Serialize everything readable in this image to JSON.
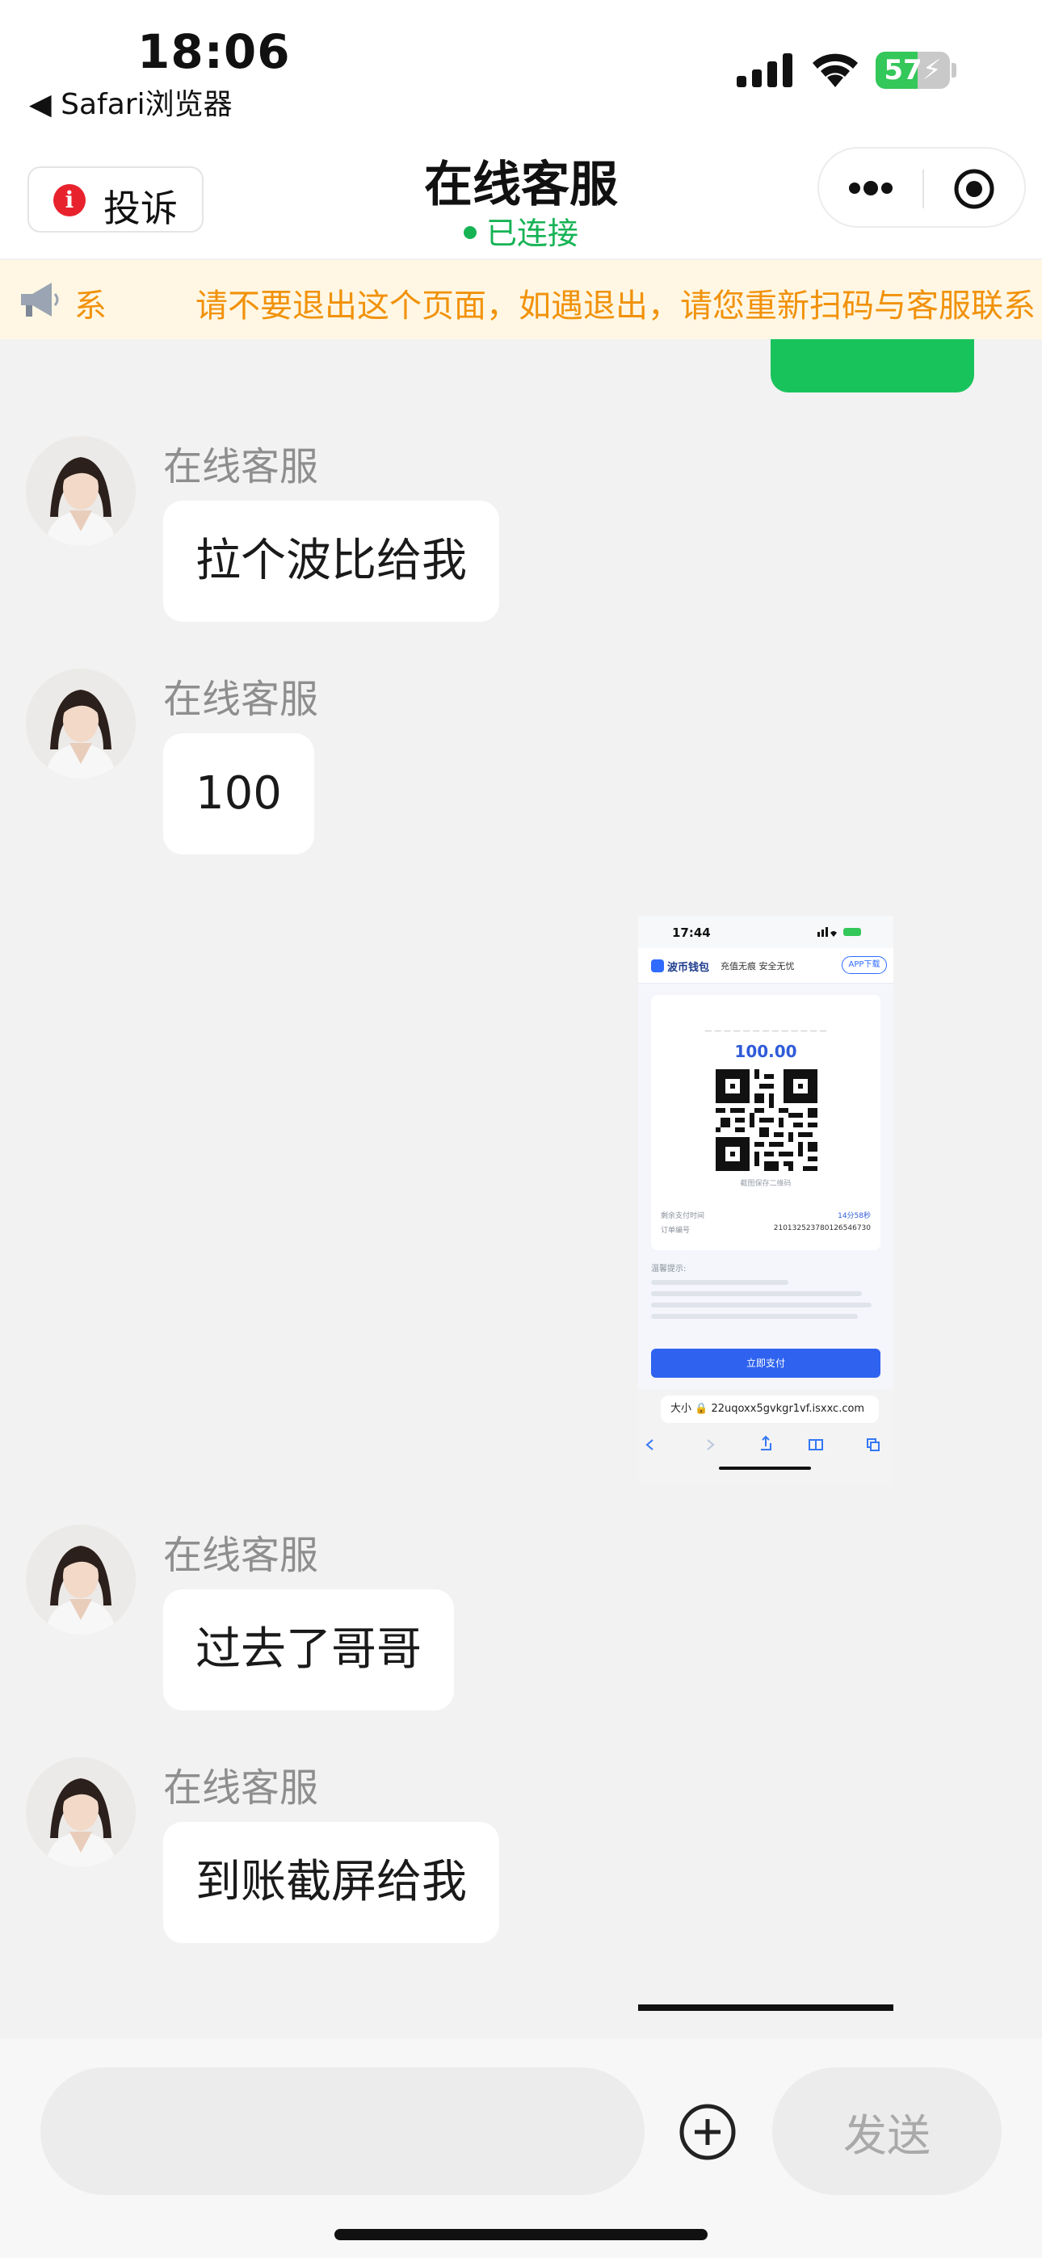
{
  "status_bar": {
    "time": "18:06",
    "back_app": "◀ Safari浏览器",
    "battery_percent": "57",
    "battery_level": 0.57,
    "icons": [
      "cellular-signal-icon",
      "wifi-icon",
      "battery-charging-icon"
    ]
  },
  "nav": {
    "complaint_label": "投诉",
    "complaint_icon_glyph": "i",
    "title": "在线客服",
    "status": "已连接",
    "status_color": "#16b355",
    "menu_icons": [
      "more-icon",
      "record-icon"
    ]
  },
  "notice": {
    "leading_fragment": "系",
    "text": "请不要退出这个页面，如遇退出，请您重新扫码与客服联系"
  },
  "messages": [
    {
      "sender": "在线客服",
      "text": "拉个波比给我"
    },
    {
      "sender": "在线客服",
      "text": "100"
    },
    {
      "sender": "在线客服",
      "text": "过去了哥哥"
    },
    {
      "sender": "在线客服",
      "text": "到账截屏给我"
    }
  ],
  "image_message": {
    "time": "17:44",
    "brand": "波币钱包",
    "brand_tagline": "充值无痕   安全无忧",
    "download_label": "APP下载",
    "amount": "100.00",
    "qr_caption": "截图保存二维码",
    "pay_time_label": "剩余支付时间",
    "pay_time_value": "14分58秒",
    "order_label": "订单编号",
    "order_value": "210132523780126546730",
    "notes_heading": "温馨提示:",
    "pay_button": "立即支付",
    "url_prefix": "大小",
    "url": "22uqoxx5gvkgr1vf.isxxc.com"
  },
  "composer": {
    "placeholder": "",
    "value": "",
    "send_label": "发送"
  },
  "colors": {
    "accent_green": "#19c35c",
    "notice_text": "#f1920b",
    "notice_bg": "#fff7e4"
  }
}
